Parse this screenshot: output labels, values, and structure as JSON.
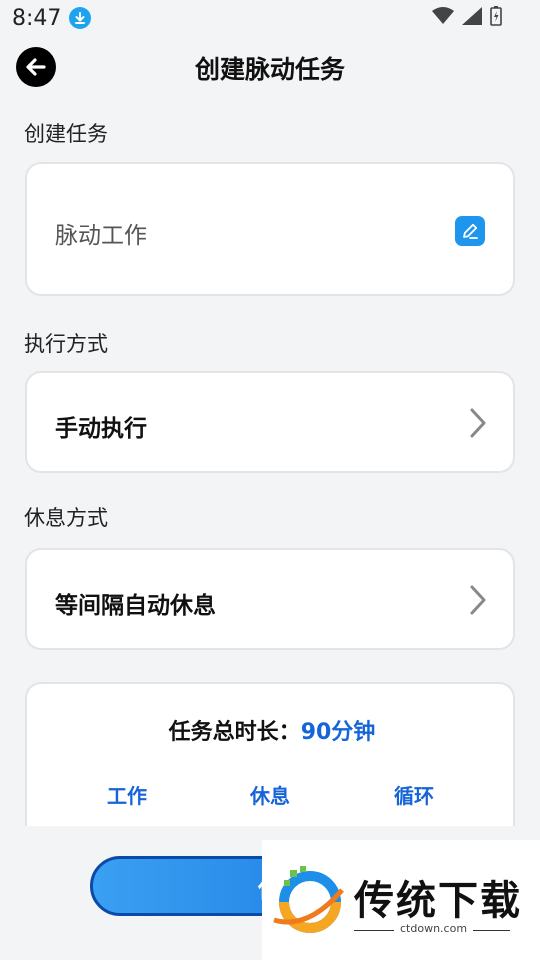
{
  "status_bar": {
    "time": "8:47"
  },
  "header": {
    "title": "创建脉动任务"
  },
  "task_section": {
    "label": "创建任务",
    "task_name": "脉动工作"
  },
  "exec_section": {
    "label": "执行方式",
    "value": "手动执行"
  },
  "rest_section": {
    "label": "休息方式",
    "value": "等间隔自动休息"
  },
  "summary": {
    "title_prefix": "任务总时长：",
    "total_value": "90分钟",
    "tabs": [
      "工作",
      "休息",
      "循环"
    ]
  },
  "save_button": {
    "label_visible": "保"
  },
  "watermark": {
    "brand": "传统下载",
    "url": "ctdown.com"
  },
  "colors": {
    "accent": "#1565d8",
    "button_blue": "#1876e0",
    "edit_icon": "#1e96ee"
  }
}
